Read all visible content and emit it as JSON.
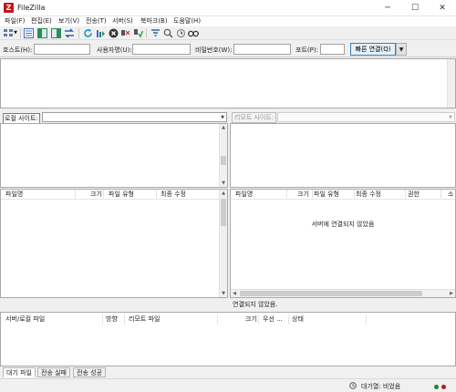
{
  "app": {
    "title": "FileZilla",
    "icon_letter": "Z"
  },
  "window_controls": {
    "minimize": "─",
    "maximize": "☐",
    "close": "✕"
  },
  "menu": [
    "파일(F)",
    "편집(E)",
    "보기(V)",
    "전송(T)",
    "서버(S)",
    "북마크(B)",
    "도움말(H)"
  ],
  "toolbar_icons": [
    "site-manager-icon",
    "dropdown-arrow-icon",
    "toggle-message-log-icon",
    "toggle-local-tree-icon",
    "toggle-remote-tree-icon",
    "toggle-queue-icon",
    "refresh-icon",
    "process-queue-icon",
    "cancel-icon",
    "disconnect-icon",
    "reconnect-icon",
    "filter-icon",
    "compare-icon",
    "sync-browse-icon",
    "search-icon"
  ],
  "quickconnect": {
    "host_label": "호스트(H):",
    "user_label": "사용자명(U):",
    "pass_label": "비밀번호(W):",
    "port_label": "포트(P):",
    "host_value": "",
    "user_value": "",
    "pass_value": "",
    "port_value": "",
    "connect_button": "빠른 연결(Q)"
  },
  "local": {
    "site_label": "로컬 사이트:",
    "path_value": "",
    "columns": [
      "파일명",
      "크기",
      "파일 유형",
      "최종 수정"
    ]
  },
  "remote": {
    "site_label": "리모트 사이트:",
    "path_value": "",
    "columns": [
      "파일명",
      "크기",
      "파일 유형",
      "최종 수정",
      "권한",
      "소"
    ],
    "empty_message": "서버에 연결되지 않았음",
    "status": "연결되지 않았음."
  },
  "queue": {
    "columns": [
      "서버/로컬 파일",
      "방향",
      "리모트 파일",
      "크기",
      "우선 ...",
      "상태"
    ],
    "tabs": [
      "대기 파일",
      "전송 실패",
      "전송 성공"
    ]
  },
  "statusbar": {
    "queue_text": "대기열: 비었음"
  },
  "colors": {
    "accent": "#3c7fb1",
    "app_icon": "#c3161b",
    "led_off_green": "#2e7d32",
    "led_off_red": "#b71c1c"
  }
}
